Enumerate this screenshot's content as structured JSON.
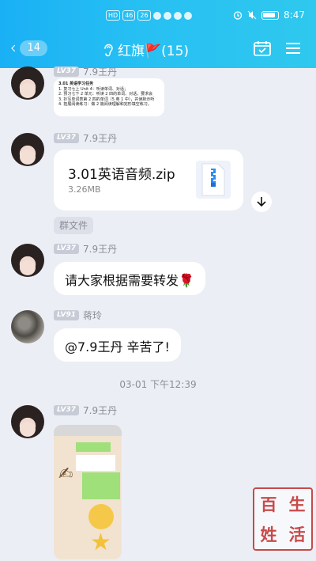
{
  "status_bar": {
    "signal_tags": [
      "HD",
      "46",
      "26"
    ],
    "time": "8:47"
  },
  "header": {
    "back_badge": "14",
    "title": "红旗🚩(15)"
  },
  "messages": [
    {
      "sender": "7.9王丹",
      "level": "LV37",
      "type": "doc_preview",
      "lines": [
        "3.01 英语学习任务",
        "1. 复习七上 Unit 4：听读单词、对话；",
        "2. 预习七下 2 单元：听读 2 四的单词、对话，要求会",
        "3. 抄写单词表第 2 四的单词（5 英 1 中），并读默示听",
        "4. 拓展阅读练习：做 2 篇阅读理解和完形填空练习。"
      ]
    },
    {
      "sender": "7.9王丹",
      "level": "LV37",
      "type": "file",
      "file_name": "3.01英语音频.zip",
      "file_size": "3.26MB"
    },
    {
      "sender": "7.9王丹",
      "level": "LV37",
      "type": "text",
      "text": "请大家根据需要转发🌹"
    },
    {
      "sender": "蒋玲",
      "level": "LV91",
      "type": "text",
      "text": "@7.9王丹 辛苦了!"
    },
    {
      "sender": "7.9王丹",
      "level": "LV37",
      "type": "image"
    }
  ],
  "system_tag": "群文件",
  "timestamp": "03-01 下午12:39",
  "watermark": {
    "chars": [
      "百",
      "生",
      "姓",
      "活"
    ]
  },
  "colors": {
    "header": "#1ab0f5",
    "background": "#eceef5"
  }
}
